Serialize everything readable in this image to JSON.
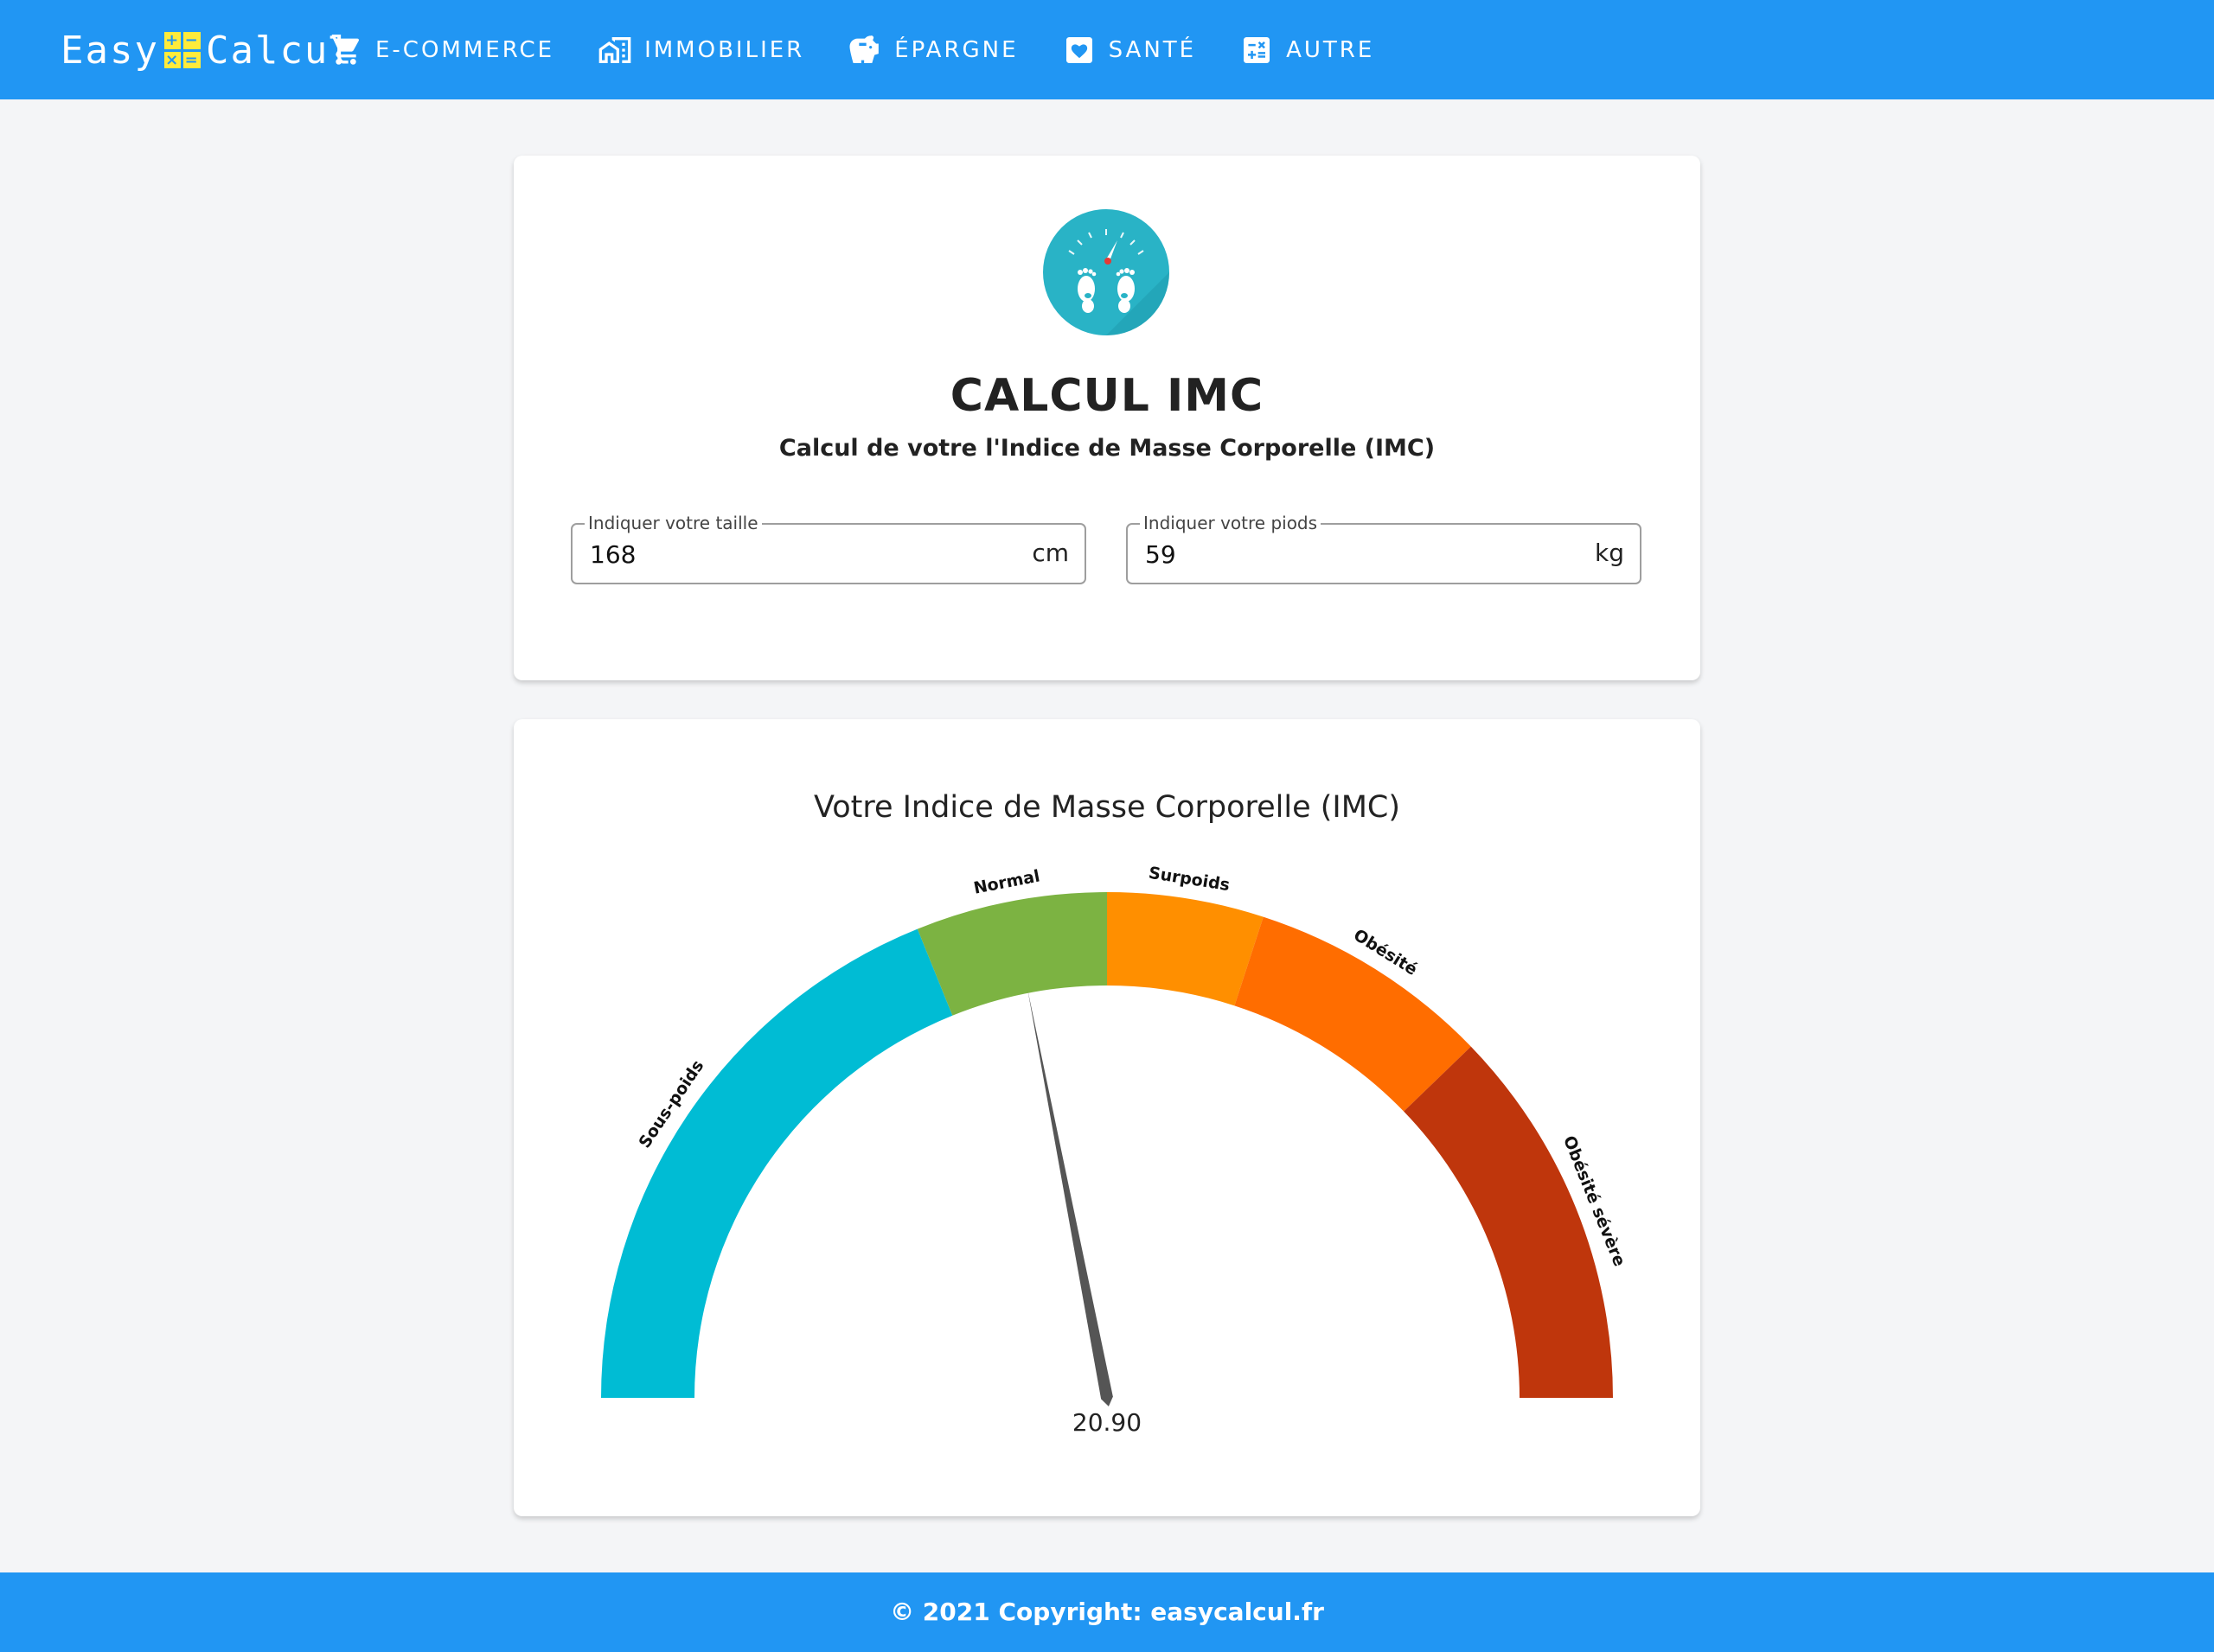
{
  "brand": {
    "left": "Easy",
    "right": "Calcul",
    "glyphs": [
      "+",
      "−",
      "×",
      "="
    ]
  },
  "nav": [
    {
      "label": "E-COMMERCE",
      "icon": "cart-icon"
    },
    {
      "label": "IMMOBILIER",
      "icon": "buildings-icon"
    },
    {
      "label": "ÉPARGNE",
      "icon": "piggy-bank-icon"
    },
    {
      "label": "SANTÉ",
      "icon": "heart-icon"
    },
    {
      "label": "AUTRE",
      "icon": "calculator-icon"
    }
  ],
  "calculator": {
    "icon": "scale-feet-icon",
    "title": "CALCUL IMC",
    "subtitle": "Calcul de votre l'Indice de Masse Corporelle (IMC)",
    "height_field": {
      "label": "Indiquer votre taille",
      "value": "168",
      "unit": "cm"
    },
    "weight_field": {
      "label": "Indiquer votre piods",
      "value": "59",
      "unit": "kg"
    }
  },
  "gauge": {
    "title": "Votre Indice de Masse Corporelle (IMC)",
    "value": 20.9,
    "value_label": "20.90",
    "segments": [
      {
        "label": "Sous-poids",
        "color": "#00bcd4"
      },
      {
        "label": "Normal",
        "color": "#7cb342"
      },
      {
        "label": "Surpoids",
        "color": "#ff8f00"
      },
      {
        "label": "Obésité",
        "color": "#ff6d00"
      },
      {
        "label": "Obésité sévère",
        "color": "#bf360c"
      }
    ]
  },
  "colors": {
    "primary": "#2196f3",
    "accent": "#ffeb3b",
    "needle": "#555555"
  },
  "footer": {
    "text": "© 2021 Copyright: easycalcul.fr"
  }
}
